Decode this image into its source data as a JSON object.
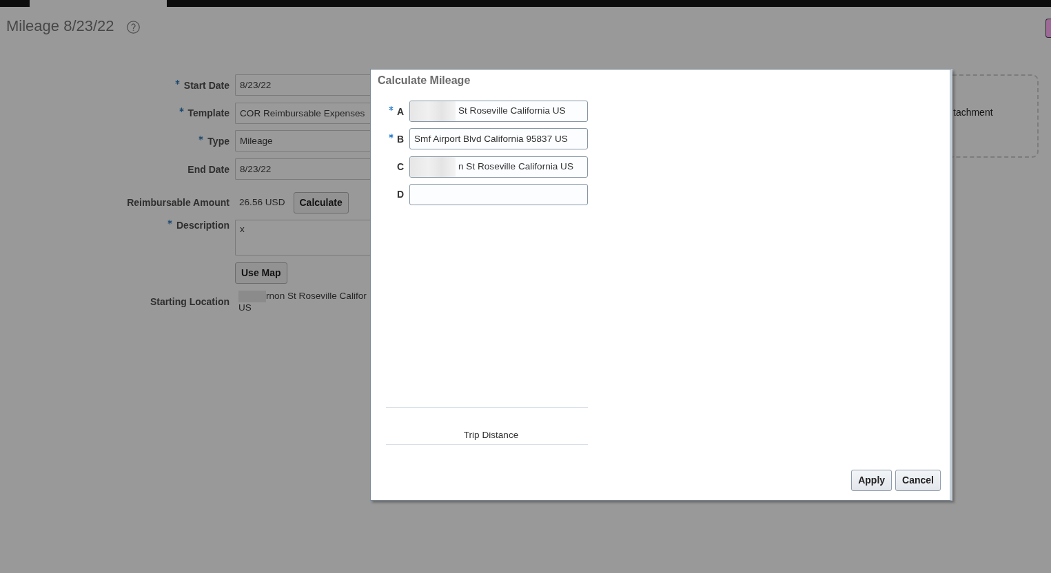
{
  "page": {
    "title": "Mileage 8/23/22"
  },
  "form": {
    "fields": [
      {
        "kind": "input",
        "label": "Start Date",
        "required": true,
        "value": "8/23/22"
      },
      {
        "kind": "input",
        "label": "Template",
        "required": true,
        "value": "COR Reimbursable Expenses"
      },
      {
        "kind": "input",
        "label": "Type",
        "required": true,
        "value": "Mileage"
      },
      {
        "kind": "input",
        "label": "End Date",
        "required": false,
        "value": "8/23/22"
      },
      {
        "kind": "amount",
        "label": "Reimbursable Amount",
        "required": false,
        "value": "26.56 USD",
        "button": "Calculate"
      },
      {
        "kind": "textarea",
        "label": "Description",
        "required": true,
        "value": "x"
      },
      {
        "kind": "button",
        "button": "Use Map"
      },
      {
        "kind": "location",
        "label": "Starting Location",
        "required": false,
        "redacted": true,
        "lines": [
          "rnon St Roseville Califor",
          "US"
        ]
      }
    ]
  },
  "attachment": {
    "text": "tachment"
  },
  "dialog": {
    "title": "Calculate Mileage",
    "stops": [
      {
        "label": "A",
        "required": true,
        "redacted": true,
        "value": "St Roseville California US"
      },
      {
        "label": "B",
        "required": true,
        "redacted": false,
        "value": "Smf Airport Blvd California 95837 US"
      },
      {
        "label": "C",
        "required": false,
        "redacted": true,
        "value": "n St Roseville California US"
      },
      {
        "label": "D",
        "required": false,
        "redacted": false
      }
    ],
    "summary": {
      "header": "Trip Distance"
    },
    "buttons": [
      {
        "label": "Apply"
      },
      {
        "label": "Cancel"
      }
    ]
  }
}
